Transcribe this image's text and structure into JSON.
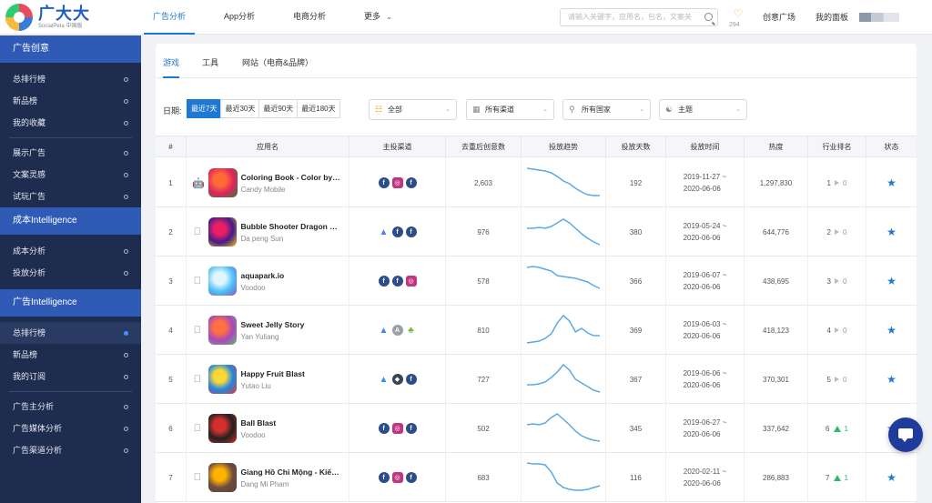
{
  "logo": {
    "name": "广大大",
    "sub": "SocialPeta 中国版"
  },
  "topnav": {
    "items": [
      {
        "label": "广告分析",
        "active": true
      },
      {
        "label": "App分析",
        "active": false
      },
      {
        "label": "电商分析",
        "active": false
      },
      {
        "label": "更多",
        "active": false
      }
    ],
    "search_placeholder": "请输入关键字，应用名，包名，文案关",
    "heart_count": "294",
    "creative_plaza": "创意广场",
    "my_board": "我的面板"
  },
  "sidebar": {
    "sections": [
      {
        "title": "广告创意",
        "items": [
          "总排行榜",
          "新品榜",
          "我的收藏",
          "展示广告",
          "文案灵感",
          "试玩广告"
        ]
      },
      {
        "title": "成本Intelligence",
        "items": [
          "成本分析",
          "投放分析"
        ]
      },
      {
        "title": "广告Intelligence",
        "items": [
          "总排行榜",
          "新品榜",
          "我的订阅",
          "广告主分析",
          "广告媒体分析",
          "广告渠道分析"
        ]
      }
    ]
  },
  "tabs": [
    "游戏",
    "工具",
    "网站（电商&品牌）"
  ],
  "filters": {
    "date_label": "日期:",
    "date_options": [
      "最近7天",
      "最近30天",
      "最近90天",
      "最近180天"
    ],
    "game_type": "全部",
    "channel": "所有渠道",
    "country": "所有国家",
    "theme": "主题"
  },
  "table": {
    "headers": [
      "#",
      "应用名",
      "主投渠道",
      "去重后创意数",
      "投放趋势",
      "投放天数",
      "投放时间",
      "热度",
      "行业排名",
      "状态"
    ],
    "rows": [
      {
        "idx": "1",
        "platform": "android",
        "name": "Coloring Book - Color by…",
        "dev": "Candy Mobile",
        "channels": [
          "fb",
          "ig",
          "fb"
        ],
        "creatives": "2,603",
        "trend": [
          34,
          33,
          32,
          31,
          29,
          25,
          20,
          17,
          12,
          8,
          5,
          4,
          4
        ],
        "days": "192",
        "date_start": "2019-11-27 ~",
        "date_end": "2020-06-06",
        "heat": "1,297,830",
        "rank": "1",
        "rank_change": "0",
        "rank_dir": "flat",
        "icon_colors": [
          "#e0245e",
          "#ff6b35",
          "#2e7d32"
        ]
      },
      {
        "idx": "2",
        "platform": "ios",
        "name": "Bubble Shooter Dragon …",
        "dev": "Da peng Sun",
        "channels": [
          "ads",
          "fb",
          "fb"
        ],
        "creatives": "976",
        "trend": [
          22,
          22,
          23,
          22,
          24,
          28,
          32,
          28,
          22,
          16,
          11,
          7,
          4
        ],
        "days": "380",
        "date_start": "2019-05-24 ~",
        "date_end": "2020-06-06",
        "heat": "644,776",
        "rank": "2",
        "rank_change": "0",
        "rank_dir": "flat",
        "icon_colors": [
          "#3f1d8c",
          "#e91e63",
          "#ffc107"
        ]
      },
      {
        "idx": "3",
        "platform": "ios",
        "name": "aquapark.io",
        "dev": "Voodoo",
        "channels": [
          "fb",
          "fb",
          "ig"
        ],
        "creatives": "578",
        "trend": [
          33,
          34,
          33,
          31,
          29,
          24,
          23,
          22,
          21,
          19,
          17,
          13,
          10
        ],
        "days": "366",
        "date_start": "2019-06-07 ~",
        "date_end": "2020-06-06",
        "heat": "438,695",
        "rank": "3",
        "rank_change": "0",
        "rank_dir": "flat",
        "icon_colors": [
          "#4fc3f7",
          "#e1f5fe",
          "#7e57c2"
        ]
      },
      {
        "idx": "4",
        "platform": "ios",
        "name": "Sweet Jelly Story",
        "dev": "Yan Yuliang",
        "channels": [
          "ads",
          "unity",
          "andr"
        ],
        "creatives": "810",
        "trend": [
          4,
          5,
          6,
          9,
          14,
          26,
          34,
          28,
          16,
          20,
          15,
          12,
          12
        ],
        "days": "369",
        "date_start": "2019-06-03 ~",
        "date_end": "2020-06-06",
        "heat": "418,123",
        "rank": "4",
        "rank_change": "0",
        "rank_dir": "flat",
        "icon_colors": [
          "#ab47bc",
          "#ff7043",
          "#66bb6a"
        ]
      },
      {
        "idx": "5",
        "platform": "ios",
        "name": "Happy Fruit Blast",
        "dev": "Yutao Liu",
        "channels": [
          "ads",
          "cube",
          "fb"
        ],
        "creatives": "727",
        "trend": [
          12,
          12,
          13,
          15,
          20,
          26,
          34,
          28,
          18,
          14,
          10,
          6,
          4
        ],
        "days": "367",
        "date_start": "2019-06-06 ~",
        "date_end": "2020-06-06",
        "heat": "370,301",
        "rank": "5",
        "rank_change": "0",
        "rank_dir": "flat",
        "icon_colors": [
          "#1e88e5",
          "#fdd835",
          "#e53935"
        ]
      },
      {
        "idx": "6",
        "platform": "ios",
        "name": "Ball Blast",
        "dev": "Voodoo",
        "channels": [
          "fb",
          "ig",
          "fb"
        ],
        "creatives": "502",
        "trend": [
          22,
          23,
          22,
          24,
          30,
          34,
          28,
          22,
          15,
          10,
          7,
          5,
          4
        ],
        "days": "345",
        "date_start": "2019-06-27 ~",
        "date_end": "2020-06-06",
        "heat": "337,642",
        "rank": "6",
        "rank_change": "1",
        "rank_dir": "up",
        "icon_colors": [
          "#212121",
          "#d32f2f",
          "#d32f2f"
        ]
      },
      {
        "idx": "7",
        "platform": "ios",
        "name": "Giang Hồ Chi Mộng - Kiế…",
        "dev": "Dang Mi Pham",
        "channels": [
          "fb",
          "ig",
          "fb"
        ],
        "creatives": "683",
        "trend": [
          34,
          33,
          33,
          32,
          24,
          12,
          7,
          5,
          4,
          4,
          5,
          7,
          9
        ],
        "days": "116",
        "date_start": "2020-02-11 ~",
        "date_end": "2020-06-06",
        "heat": "286,883",
        "rank": "7",
        "rank_change": "1",
        "rank_dir": "up",
        "icon_colors": [
          "#6d4c41",
          "#ffb300",
          "#5d4037"
        ]
      }
    ]
  },
  "colors": {
    "accent": "#1f78d1",
    "sidebar_bg": "#1e2c4f",
    "sidebar_section": "#2f5bb7",
    "trend_line": "#5aa9e6",
    "rank_up": "#2eb872"
  }
}
